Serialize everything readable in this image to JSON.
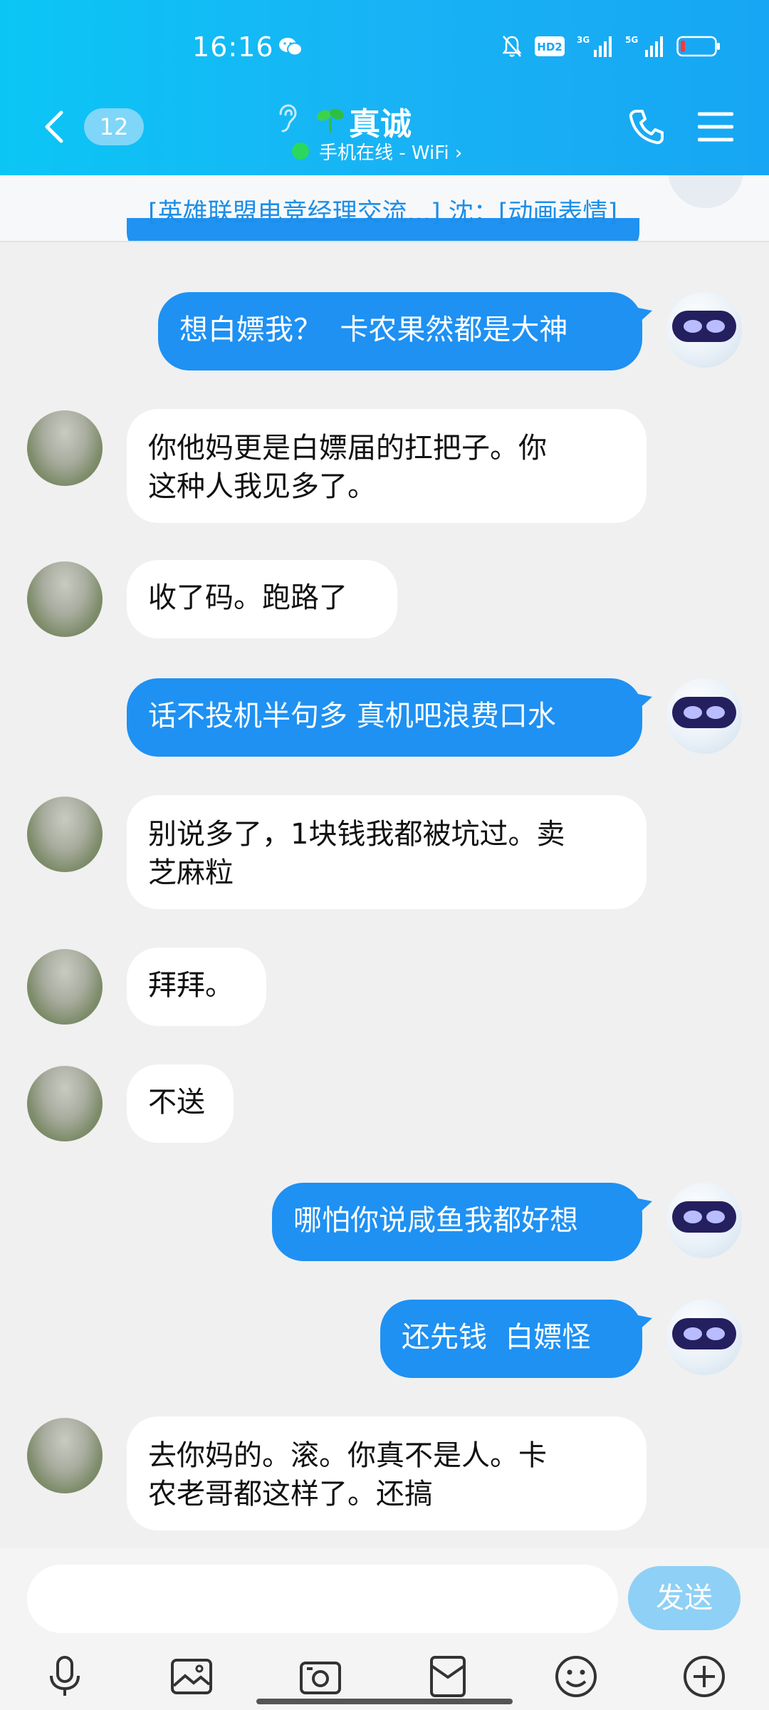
{
  "status_bar": {
    "time": "16:16",
    "hd_badge": "HD2",
    "network_1": "3G",
    "network_2": "5G"
  },
  "header": {
    "unread_count": "12",
    "contact_name": "真诚",
    "online_status": "手机在线 - WiFi ›"
  },
  "banner": {
    "text": "[英雄联盟电竞经理交流...] 沈：[动画表情]"
  },
  "messages": [
    {
      "side": "out",
      "text": "想白嫖我？  卡农果然都是大神"
    },
    {
      "side": "in",
      "text": "你他妈更是白嫖届的扛把子。你\n这种人我见多了。"
    },
    {
      "side": "in",
      "text": "收了码。跑路了"
    },
    {
      "side": "out",
      "text": "话不投机半句多 真机吧浪费口水"
    },
    {
      "side": "in",
      "text": "别说多了，1块钱我都被坑过。卖\n芝麻粒"
    },
    {
      "side": "in",
      "text": "拜拜。"
    },
    {
      "side": "in",
      "text": "不送"
    },
    {
      "side": "out",
      "text": "哪怕你说咸鱼我都好想"
    },
    {
      "side": "out",
      "text": "还先钱  白嫖怪"
    },
    {
      "side": "in",
      "text": "去你妈的。滚。你真不是人。卡\n农老哥都这样了。还搞"
    }
  ],
  "input": {
    "placeholder": "",
    "send_label": "发送"
  },
  "toolbar": {
    "icons": [
      "microphone-icon",
      "image-icon",
      "camera-icon",
      "red-packet-icon",
      "emoji-icon",
      "plus-icon"
    ]
  },
  "colors": {
    "header_gradient_start": "#0bc6f5",
    "header_gradient_end": "#17a6f3",
    "outgoing_bubble": "#1e91f3",
    "incoming_bubble": "#ffffff",
    "send_button": "#8fd0f6"
  }
}
